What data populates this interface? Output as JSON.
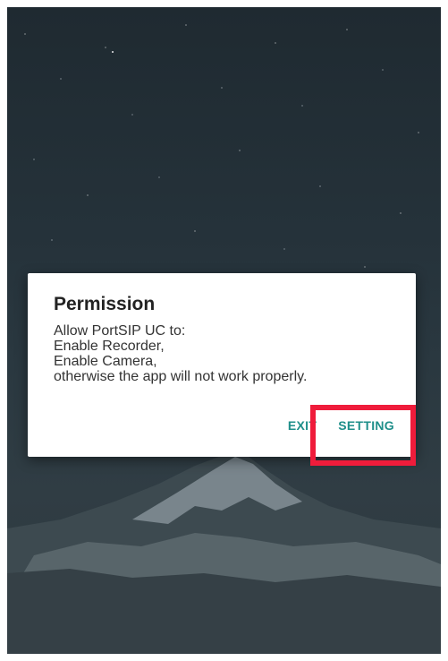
{
  "dialog": {
    "title": "Permission",
    "message_lines": [
      "Allow PortSIP UC to:",
      "Enable Recorder,",
      "Enable Camera,",
      "otherwise the app will not work properly."
    ],
    "buttons": {
      "exit_label": "EXIT",
      "setting_label": "SETTING"
    }
  },
  "colors": {
    "accent": "#1f8f8a",
    "highlight": "#ef1c3b",
    "background_top": "#1f2a31"
  }
}
